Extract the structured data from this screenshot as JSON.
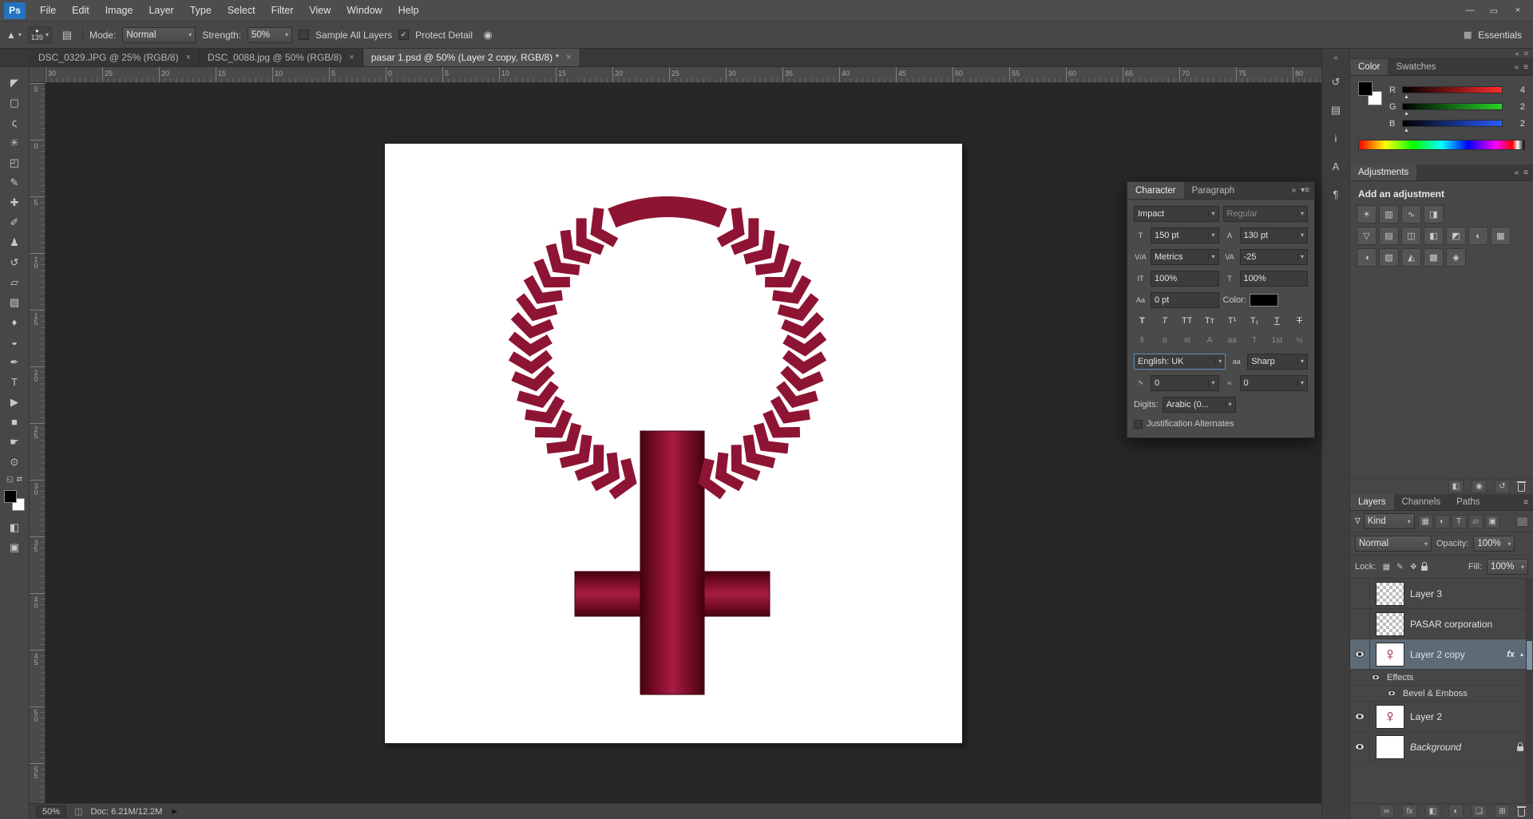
{
  "window": {
    "logo": "Ps",
    "minimize": "—",
    "restore": "▭",
    "close": "×"
  },
  "icons": {
    "check": "✓"
  },
  "menubar": {
    "items": [
      "File",
      "Edit",
      "Image",
      "Layer",
      "Type",
      "Select",
      "Filter",
      "View",
      "Window",
      "Help"
    ]
  },
  "options_bar": {
    "brush_size": "139",
    "mode_label": "Mode:",
    "mode_value": "Normal",
    "strength_label": "Strength:",
    "strength_value": "50%",
    "sample_all_layers_label": "Sample All Layers",
    "protect_detail_label": "Protect Detail",
    "workspace_label": "Essentials"
  },
  "document_tabs": [
    {
      "label": "DSC_0329.JPG @ 25% (RGB/8)",
      "close": "×",
      "active": false
    },
    {
      "label": "DSC_0088.jpg @ 50% (RGB/8)",
      "close": "×",
      "active": false
    },
    {
      "label": "pasar 1.psd @ 50% (Layer 2 copy, RGB/8) *",
      "close": "×",
      "active": true
    }
  ],
  "tools": [
    {
      "name": "move-tool",
      "glyph": "◤"
    },
    {
      "name": "rectangular-marquee-tool",
      "glyph": "▢"
    },
    {
      "name": "lasso-tool",
      "glyph": "ς"
    },
    {
      "name": "quick-selection-tool",
      "glyph": "✳"
    },
    {
      "name": "crop-tool",
      "glyph": "◰"
    },
    {
      "name": "eyedropper-tool",
      "glyph": "✎"
    },
    {
      "name": "spot-healing-brush-tool",
      "glyph": "✚"
    },
    {
      "name": "brush-tool",
      "glyph": "✐"
    },
    {
      "name": "clone-stamp-tool",
      "glyph": "♟"
    },
    {
      "name": "history-brush-tool",
      "glyph": "↺"
    },
    {
      "name": "eraser-tool",
      "glyph": "▱"
    },
    {
      "name": "gradient-tool",
      "glyph": "▨"
    },
    {
      "name": "blur-tool",
      "glyph": "♦"
    },
    {
      "name": "dodge-tool",
      "glyph": "◒"
    },
    {
      "name": "pen-tool",
      "glyph": "✒"
    },
    {
      "name": "type-tool",
      "glyph": "T"
    },
    {
      "name": "path-selection-tool",
      "glyph": "▶"
    },
    {
      "name": "shape-tool",
      "glyph": "■"
    },
    {
      "name": "hand-tool",
      "glyph": "☛"
    },
    {
      "name": "zoom-tool",
      "glyph": "⊙"
    }
  ],
  "rulers": {
    "horizontal": [
      "30",
      "25",
      "20",
      "15",
      "10",
      "5",
      "0",
      "5",
      "10",
      "15",
      "20",
      "25",
      "30",
      "35",
      "40",
      "45",
      "50",
      "55",
      "60",
      "65",
      "70",
      "75",
      "80"
    ],
    "vertical": [
      "5",
      "0",
      "5",
      "10",
      "15",
      "20",
      "25",
      "30",
      "35",
      "40",
      "45",
      "50",
      "55"
    ]
  },
  "status_bar": {
    "zoom": "50%",
    "doc_info": "Doc: 6.21M/12.2M"
  },
  "collapsed_panels": [
    {
      "name": "expand-panels-icon",
      "glyph": "«"
    },
    {
      "name": "history-panel-icon",
      "glyph": "↺"
    },
    {
      "name": "properties-panel-icon",
      "glyph": "▤"
    },
    {
      "name": "info-panel-icon",
      "glyph": "i"
    },
    {
      "name": "character-panel-icon",
      "glyph": "A"
    },
    {
      "name": "paragraph-panel-icon",
      "glyph": "¶"
    }
  ],
  "color_panel": {
    "tabs": [
      {
        "label": "Color",
        "active": true
      },
      {
        "label": "Swatches",
        "active": false
      }
    ],
    "channels": [
      {
        "label": "R",
        "value": "4",
        "color": "#ff2a2a"
      },
      {
        "label": "G",
        "value": "2",
        "color": "#27d427"
      },
      {
        "label": "B",
        "value": "2",
        "color": "#2a5cff"
      }
    ]
  },
  "adjustments_panel": {
    "title": "Adjustments",
    "subtitle": "Add an adjustment",
    "icons": [
      [
        {
          "name": "brightness-contrast-adjustment-icon",
          "glyph": "☀"
        },
        {
          "name": "levels-adjustment-icon",
          "glyph": "▥"
        },
        {
          "name": "curves-adjustment-icon",
          "glyph": "∿"
        },
        {
          "name": "exposure-adjustment-icon",
          "glyph": "◨"
        }
      ],
      [
        {
          "name": "vibrance-adjustment-icon",
          "glyph": "▽"
        },
        {
          "name": "hue-saturation-adjustment-icon",
          "glyph": "▤"
        },
        {
          "name": "color-balance-adjustment-icon",
          "glyph": "◫"
        },
        {
          "name": "black-white-adjustment-icon",
          "glyph": "◧"
        },
        {
          "name": "photo-filter-adjustment-icon",
          "glyph": "◩"
        },
        {
          "name": "channel-mixer-adjustment-icon",
          "glyph": "◐"
        },
        {
          "name": "color-lookup-adjustment-icon",
          "glyph": "▦"
        }
      ],
      [
        {
          "name": "invert-adjustment-icon",
          "glyph": "◑"
        },
        {
          "name": "posterize-adjustment-icon",
          "glyph": "▧"
        },
        {
          "name": "threshold-adjustment-icon",
          "glyph": "◭"
        },
        {
          "name": "gradient-map-adjustment-icon",
          "glyph": "▩"
        },
        {
          "name": "selective-color-adjustment-icon",
          "glyph": "◈"
        }
      ]
    ],
    "footer_icons": [
      {
        "name": "clip-adjustment-icon",
        "glyph": "◧"
      },
      {
        "name": "toggle-visibility-icon",
        "glyph": "◉"
      },
      {
        "name": "reset-adjustment-icon",
        "glyph": "↺"
      },
      {
        "name": "delete-adjustment-icon",
        "glyph": "trash"
      }
    ]
  },
  "character_panel": {
    "tabs": [
      {
        "label": "Character",
        "active": true
      },
      {
        "label": "Paragraph",
        "active": false
      }
    ],
    "font_family": "Impact",
    "font_style": "Regular",
    "font_size": "150 pt",
    "leading": "130 pt",
    "kerning": "Metrics",
    "tracking": "-25",
    "vertical_scale": "100%",
    "horizontal_scale": "100%",
    "baseline_shift": "0 pt",
    "color_label": "Color:",
    "language": "English: UK",
    "anti_alias": "Sharp",
    "kashida_left": "0",
    "kashida_right": "0",
    "digits_label": "Digits:",
    "digits_value": "Arabic (0...",
    "justification_label": "Justification Alternates",
    "format_buttons": [
      {
        "name": "faux-bold-button",
        "glyph": "T",
        "cls": "b"
      },
      {
        "name": "faux-italic-button",
        "glyph": "T",
        "cls": "i"
      },
      {
        "name": "all-caps-button",
        "glyph": "TT",
        "cls": ""
      },
      {
        "name": "small-caps-button",
        "glyph": "Tᴛ",
        "cls": ""
      },
      {
        "name": "superscript-button",
        "glyph": "T¹",
        "cls": ""
      },
      {
        "name": "subscript-button",
        "glyph": "T₁",
        "cls": ""
      },
      {
        "name": "underline-button",
        "glyph": "T",
        "cls": "u"
      },
      {
        "name": "strikethrough-button",
        "glyph": "T",
        "cls": "s"
      }
    ],
    "opentype_buttons": [
      {
        "name": "ligatures-button",
        "glyph": "fi"
      },
      {
        "name": "contextual-alternates-button",
        "glyph": "ɑ"
      },
      {
        "name": "discretionary-ligatures-button",
        "glyph": "st"
      },
      {
        "name": "swash-button",
        "glyph": "A"
      },
      {
        "name": "stylistic-alternates-button",
        "glyph": "aa"
      },
      {
        "name": "titling-alternates-button",
        "glyph": "T"
      },
      {
        "name": "ordinals-button",
        "glyph": "1st"
      },
      {
        "name": "fractions-button",
        "glyph": "½"
      }
    ]
  },
  "layers_panel": {
    "tabs": [
      {
        "label": "Layers",
        "active": true
      },
      {
        "label": "Channels",
        "active": false
      },
      {
        "label": "Paths",
        "active": false
      }
    ],
    "kind_filter": "Kind",
    "blend_mode": "Normal",
    "opacity_label": "Opacity:",
    "opacity_value": "100%",
    "lock_label": "Lock:",
    "fill_label": "Fill:",
    "fill_value": "100%",
    "fx_badge": "fx",
    "filter_icons": [
      {
        "name": "filter-pixel-layers-icon",
        "glyph": "▦"
      },
      {
        "name": "filter-adjustment-layers-icon",
        "glyph": "◐"
      },
      {
        "name": "filter-type-layers-icon",
        "glyph": "T"
      },
      {
        "name": "filter-shape-layers-icon",
        "glyph": "▱"
      },
      {
        "name": "filter-smart-objects-icon",
        "glyph": "▣"
      }
    ],
    "lock_icons": [
      {
        "name": "lock-transparency-icon",
        "glyph": "▦"
      },
      {
        "name": "lock-pixels-icon",
        "glyph": "✎"
      },
      {
        "name": "lock-position-icon",
        "glyph": "✥"
      },
      {
        "name": "lock-all-icon",
        "glyph": "padlock"
      }
    ],
    "layers": [
      {
        "name": "Layer 3",
        "visible": false,
        "thumb": "checker",
        "type": "layer"
      },
      {
        "name": "PASAR corporation",
        "visible": false,
        "thumb": "checker",
        "type": "layer"
      },
      {
        "name": "Layer 2 copy",
        "visible": true,
        "thumb": "symbol",
        "type": "layer",
        "selected": true,
        "fx": true
      },
      {
        "name": "Effects",
        "visible": true,
        "type": "effect",
        "indent": 1
      },
      {
        "name": "Bevel & Emboss",
        "visible": true,
        "type": "effect",
        "indent": 2
      },
      {
        "name": "Layer 2",
        "visible": true,
        "thumb": "symbol",
        "type": "layer"
      },
      {
        "name": "Background",
        "visible": true,
        "thumb": "white",
        "type": "layer",
        "locked": true,
        "italic": true
      }
    ],
    "footer_icons": [
      {
        "name": "link-layers-icon",
        "glyph": "∞"
      },
      {
        "name": "layer-style-icon",
        "glyph": "fx"
      },
      {
        "name": "layer-mask-icon",
        "glyph": "◧"
      },
      {
        "name": "adjustment-layer-icon",
        "glyph": "◐"
      },
      {
        "name": "new-group-icon",
        "glyph": "❏"
      },
      {
        "name": "new-layer-icon",
        "glyph": "⊞"
      },
      {
        "name": "delete-layer-icon",
        "glyph": "trash"
      }
    ]
  },
  "artwork": {
    "symbol": "female-symbol-chevron-wreath",
    "chevron_color": "#8e1434",
    "chevron_dark": "#3f0210",
    "bar_light": "#a81b42",
    "bar_mid": "#6d0a22",
    "bar_dark": "#45020f",
    "canvas_bg": "#ffffff"
  }
}
